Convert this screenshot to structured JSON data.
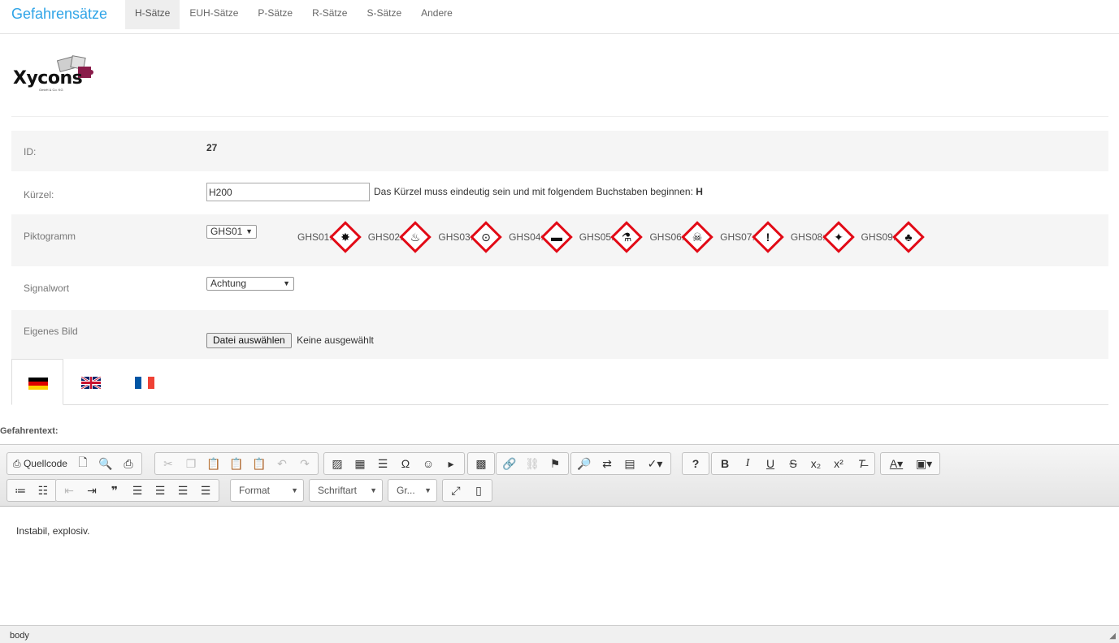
{
  "nav": {
    "brand": "Gefahrensätze",
    "items": [
      "H-Sätze",
      "EUH-Sätze",
      "P-Sätze",
      "R-Sätze",
      "S-Sätze",
      "Andere"
    ]
  },
  "logo": {
    "name": "Xycons",
    "sub": "GmbH & Co. KG"
  },
  "form": {
    "id_label": "ID:",
    "id_value": "27",
    "kuerzel_label": "Kürzel:",
    "kuerzel_value": "H200",
    "kuerzel_hint": "Das Kürzel muss eindeutig sein und mit folgendem Buchstaben beginnen:",
    "kuerzel_hint_letter": "H",
    "pikto_label": "Piktogramm",
    "pikto_selected": "GHS01",
    "ghs": [
      {
        "label": "GHS01:",
        "icon": "explosive-icon",
        "glyph": "✸"
      },
      {
        "label": "GHS02:",
        "icon": "flame-icon",
        "glyph": "🔥"
      },
      {
        "label": "GHS03:",
        "icon": "flame-over-circle-icon",
        "glyph": "⊙"
      },
      {
        "label": "GHS04:",
        "icon": "gas-cylinder-icon",
        "glyph": "▬"
      },
      {
        "label": "GHS05:",
        "icon": "corrosion-icon",
        "glyph": "⚗"
      },
      {
        "label": "GHS06:",
        "icon": "skull-icon",
        "glyph": "☠"
      },
      {
        "label": "GHS07:",
        "icon": "exclamation-icon",
        "glyph": "!"
      },
      {
        "label": "GHS08:",
        "icon": "health-hazard-icon",
        "glyph": "✦"
      },
      {
        "label": "GHS09:",
        "icon": "environment-icon",
        "glyph": "♣"
      }
    ],
    "signal_label": "Signalwort",
    "signal_selected": "Achtung",
    "bild_label": "Eigenes Bild",
    "file_button": "Datei auswählen",
    "file_status": "Keine ausgewählt"
  },
  "tabs": [
    "de",
    "en",
    "fr"
  ],
  "gefahrentext_label": "Gefahrentext:",
  "editor": {
    "source_label": "Quellcode",
    "format_label": "Format",
    "font_label": "Schriftart",
    "size_label": "Gr...",
    "content": "Instabil, explosiv.",
    "status": "body"
  },
  "colors": {
    "brand": "#2fa4e7",
    "ghs_red": "#e20a16"
  }
}
